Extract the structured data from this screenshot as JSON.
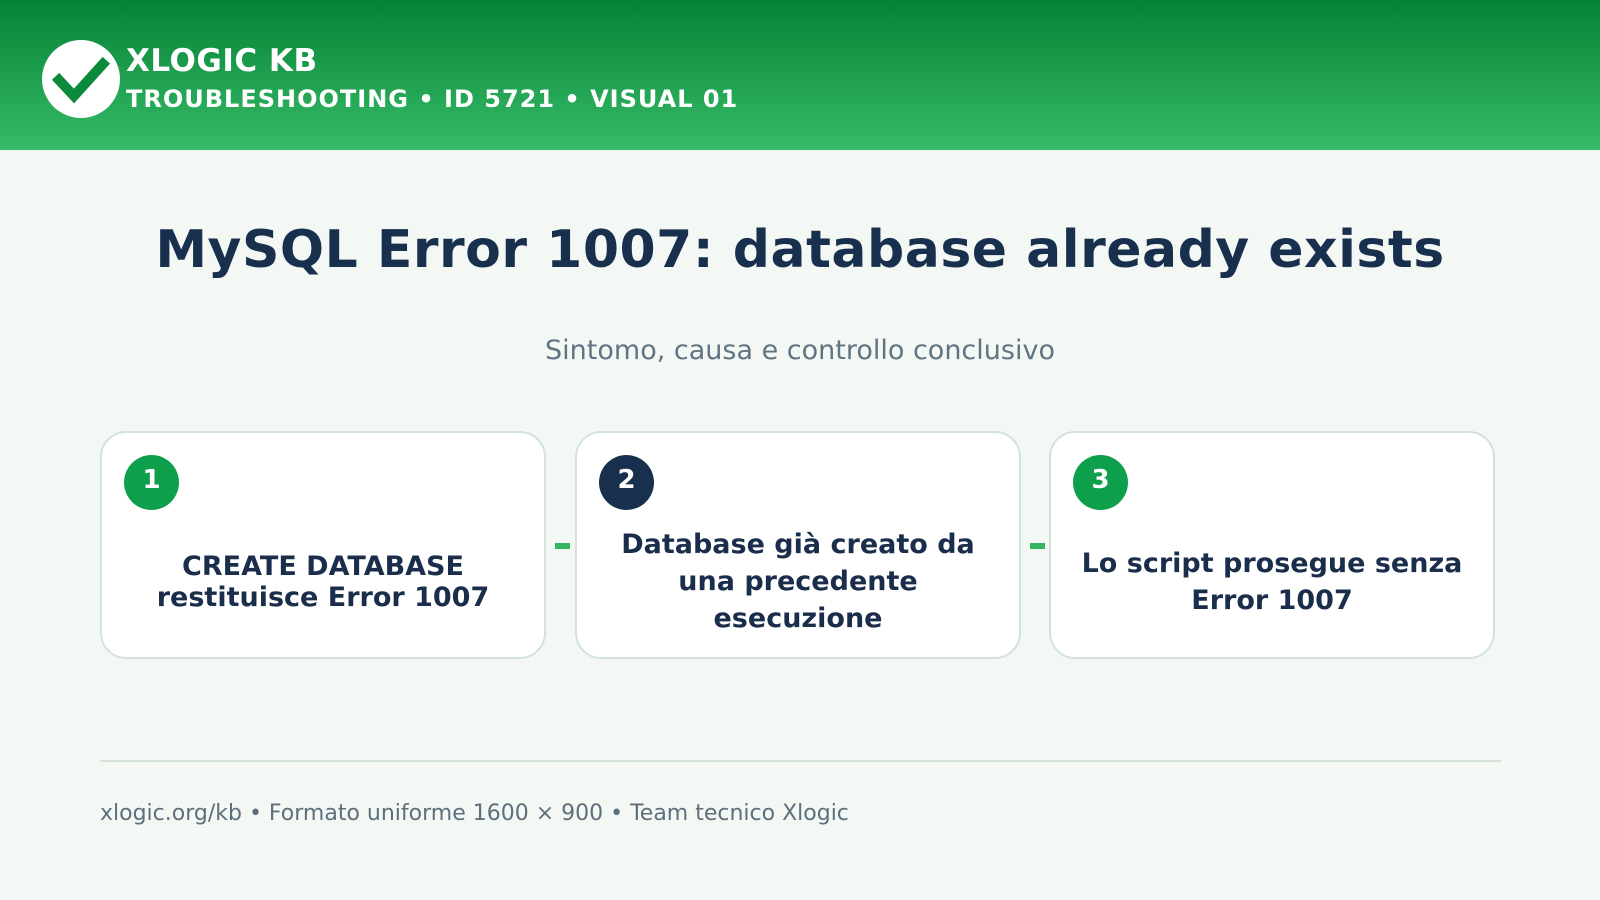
{
  "header": {
    "brand": "XLOGIC KB",
    "subline": "TROUBLESHOOTING • ID 5721 • VISUAL 01",
    "logo_icon": "checkmark-icon",
    "colors": {
      "gradient_top": "#068236",
      "gradient_bottom": "#36bb68"
    }
  },
  "main": {
    "title": "MySQL Error 1007: database already exists",
    "subtitle": "Sintomo, causa e controllo conclusivo"
  },
  "steps": [
    {
      "number": "1",
      "text": "CREATE DATABASE restituisce Error 1007",
      "badge_color": "#0e9f4d"
    },
    {
      "number": "2",
      "text": "Database già creato da una precedente esecuzione",
      "badge_color": "#18304d"
    },
    {
      "number": "3",
      "text": "Lo script prosegue senza Error 1007",
      "badge_color": "#0e9f4d"
    }
  ],
  "footer": {
    "text": "xlogic.org/kb • Formato uniforme 1600 × 900 • Team tecnico Xlogic"
  },
  "colors": {
    "background": "#f4f8f5",
    "title": "#18304d",
    "accent": "#36b563"
  }
}
